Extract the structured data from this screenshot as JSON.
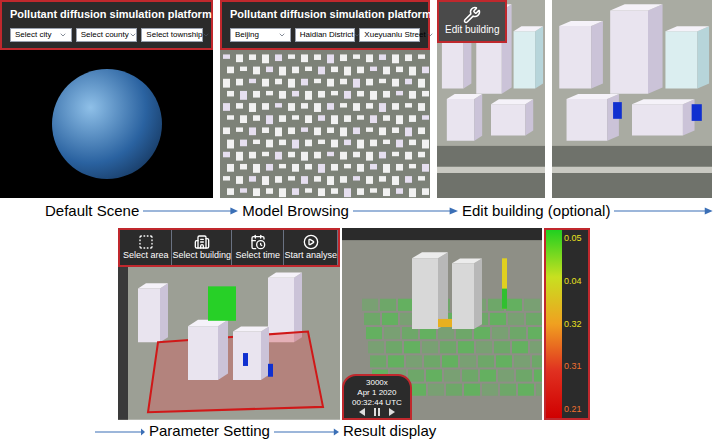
{
  "default_scene": {
    "title": "Pollutant diffusion simulation platform",
    "selects": [
      "Select city",
      "Select county",
      "Select township"
    ],
    "caption": "Default Scene"
  },
  "model_browsing": {
    "title": "Pollutant diffusion simulation platform",
    "selects": [
      "Beijing",
      "Haidian District",
      "Xueyuanlu Street"
    ],
    "caption": "Model Browsing"
  },
  "edit_building": {
    "button": "Edit building",
    "caption": "Edit building (optional)"
  },
  "parameter_setting": {
    "tools": [
      "Select area",
      "Select building",
      "Select time",
      "Start analyse"
    ],
    "caption": "Parameter Setting"
  },
  "result_display": {
    "caption": "Result display",
    "time": {
      "speed": "3000x",
      "date": "Apr 1 2020",
      "clock": "00:32:44 UTC"
    },
    "legend": [
      "0.05",
      "0.04",
      "0.32",
      "0.31",
      "0.21"
    ]
  }
}
